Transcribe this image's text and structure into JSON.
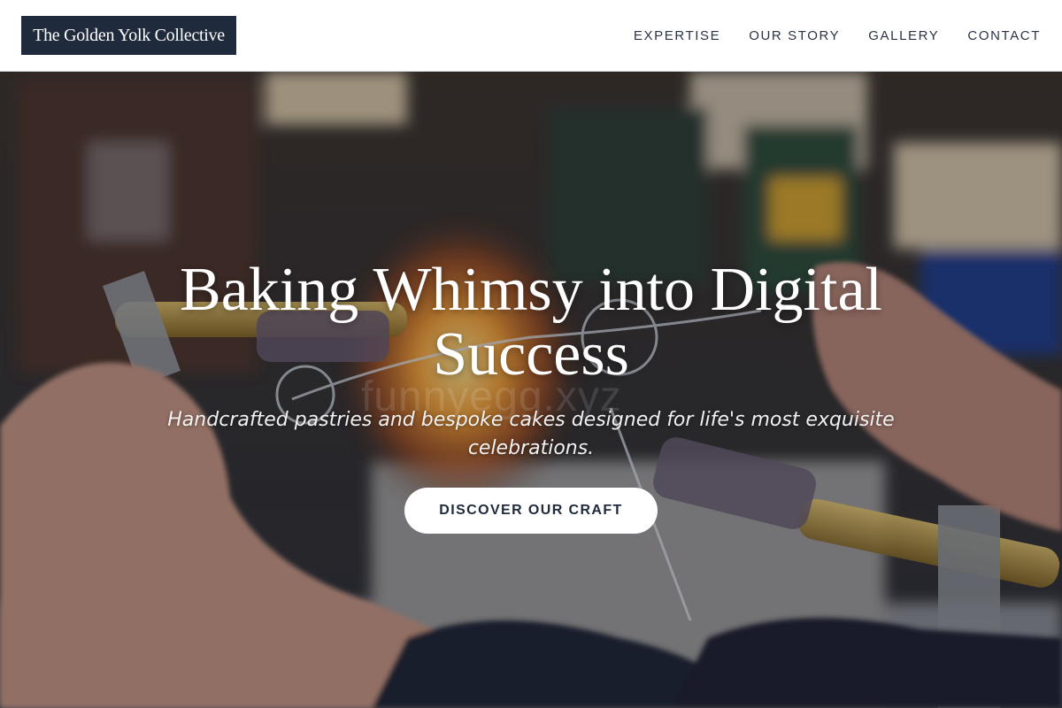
{
  "brand": {
    "name": "The Golden Yolk Collective",
    "logo_bg": "#1f2a3c"
  },
  "nav": {
    "items": [
      {
        "label": "EXPERTISE"
      },
      {
        "label": "OUR STORY"
      },
      {
        "label": "GALLERY"
      },
      {
        "label": "CONTACT"
      }
    ]
  },
  "hero": {
    "title": "Baking Whimsy into Digital Success",
    "subtitle": "Handcrafted pastries and bespoke cakes designed for life's most exquisite celebrations.",
    "cta_label": "DISCOVER OUR CRAFT",
    "watermark": "funnyegg.xyz",
    "image_subject": "glassblowing-photo"
  },
  "colors": {
    "accent": "#1f2a3c",
    "header_bg": "#ffffff",
    "nav_text": "#2b3444",
    "cta_bg": "#ffffff"
  }
}
